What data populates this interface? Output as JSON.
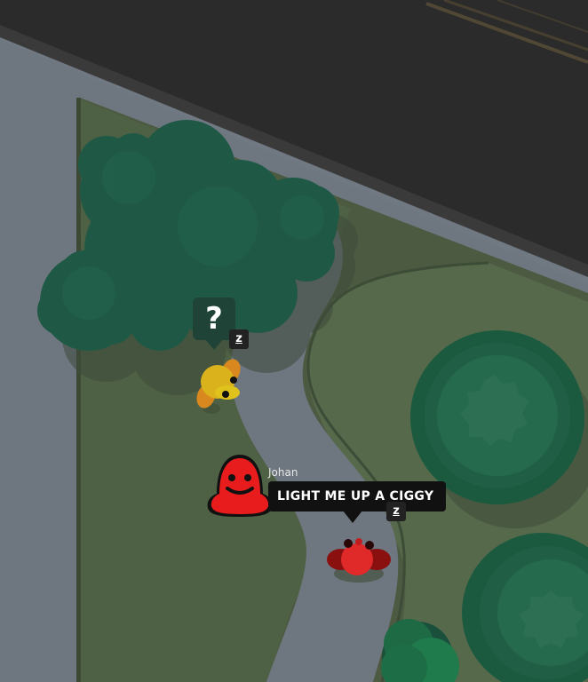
{
  "chat": {
    "speaker_name": "Johan",
    "message": "LIGHT ME UP A CIGGY",
    "speaker_color": "#e81c1c"
  },
  "status": {
    "question_glyph": "?",
    "sleep_glyph": "z"
  },
  "colors": {
    "road": "#2b2b2b",
    "sidewalk": "#707882",
    "grass": "#4c5a42",
    "tree_dark": "#1e5a45",
    "tree_light": "#2b6b4f",
    "player_yellow": "#d9b21c",
    "player_red": "#e02a2a"
  }
}
